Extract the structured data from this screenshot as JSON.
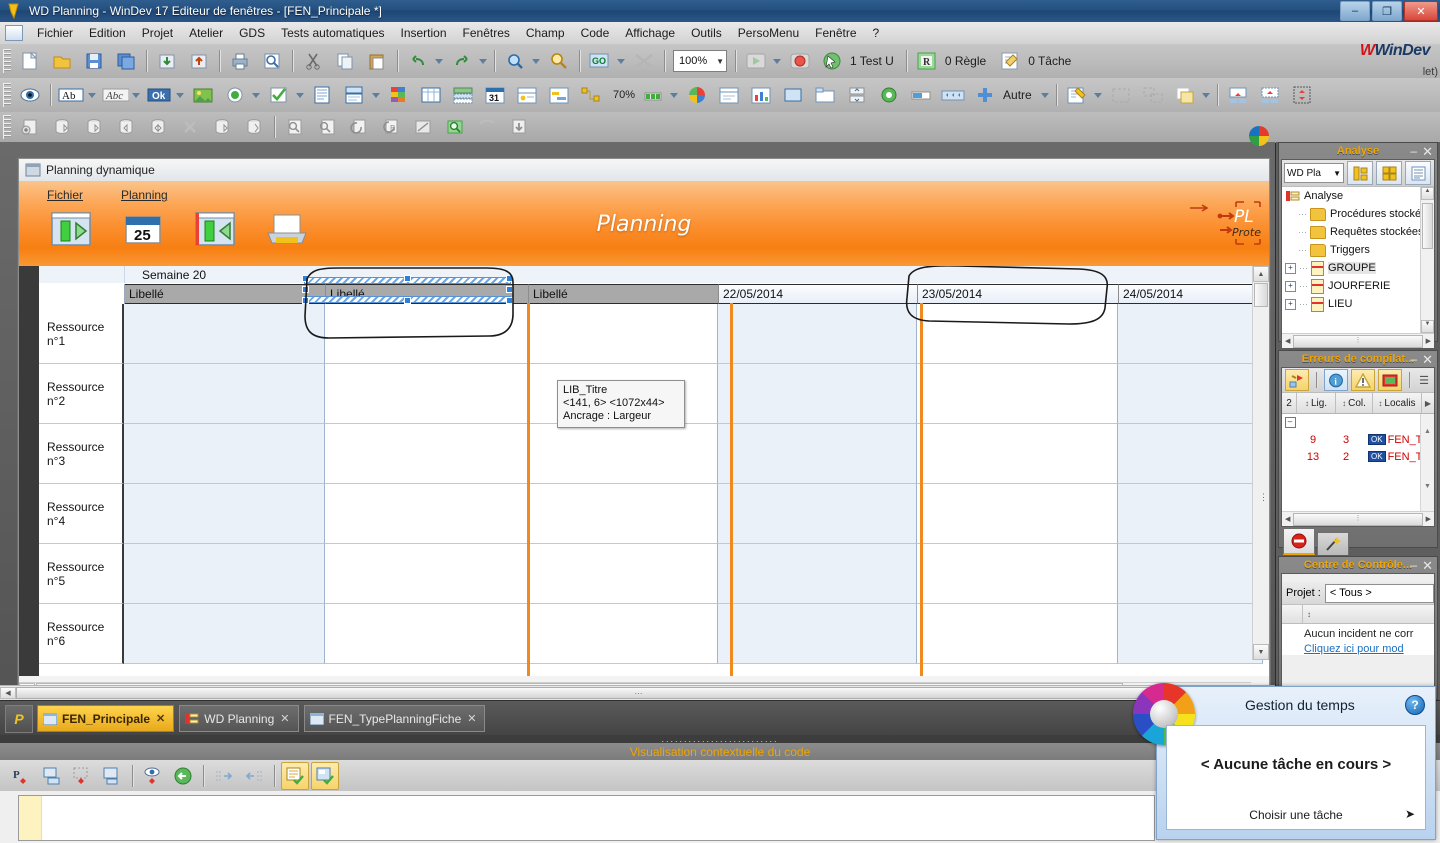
{
  "titlebar": {
    "text": "WD Planning - WinDev 17  Editeur de fenêtres - [FEN_Principale *]",
    "minimize": "–",
    "maximize": "❐",
    "close": "✕"
  },
  "menubar": {
    "items": [
      {
        "label": "Fichier"
      },
      {
        "label": "Edition"
      },
      {
        "label": "Projet"
      },
      {
        "label": "Atelier"
      },
      {
        "label": "GDS"
      },
      {
        "label": "Tests automatiques"
      },
      {
        "label": "Insertion"
      },
      {
        "label": "Fenêtres"
      },
      {
        "label": "Champ"
      },
      {
        "label": "Code"
      },
      {
        "label": "Affichage"
      },
      {
        "label": "Outils"
      },
      {
        "label": "PersoMenu"
      },
      {
        "label": "Fenêtre"
      },
      {
        "label": "?"
      }
    ]
  },
  "toolbar1": {
    "zoom_value": "100%",
    "test_label": "1 Test U",
    "rule_label": "0 Règle",
    "task_label": "0 Tâche"
  },
  "toolbar2": {
    "ab_label": "Ab",
    "abc_label": "Abc",
    "ok_label": "Ok",
    "pct_label": "70%",
    "autre_label": "Autre"
  },
  "brand": {
    "name": "WinDev",
    "suffix": "let)"
  },
  "child_window": {
    "title": "Planning dynamique",
    "banner_menu": [
      "Fichier",
      "Planning"
    ],
    "banner_title": "Planning",
    "banner_right_line1": "PL",
    "banner_right_line2": "Prote"
  },
  "tooltip": {
    "line1": "LIB_Titre",
    "line2": "<141, 6> <1072x44>",
    "line3": "Ancrage : Largeur"
  },
  "planning": {
    "week_label": "Semaine 20",
    "column_headers": [
      "Libellé",
      "Libellé",
      "Libellé",
      "22/05/2014",
      "23/05/2014",
      "24/05/2014"
    ],
    "resources": [
      "Ressource n°1",
      "Ressource n°2",
      "Ressource n°3",
      "Ressource n°4",
      "Ressource n°5",
      "Ressource n°6"
    ]
  },
  "panels": {
    "analyse": {
      "title": "Analyse",
      "minimize": "–",
      "close": "✕",
      "combo_value": "WD Pla",
      "combo_caret": "▾",
      "tree": [
        {
          "label": "Analyse",
          "type": "root",
          "indent": 0,
          "expander": ""
        },
        {
          "label": "Procédures stockée",
          "type": "folder",
          "indent": 1,
          "expander": ""
        },
        {
          "label": "Requêtes stockées",
          "type": "folder",
          "indent": 1,
          "expander": ""
        },
        {
          "label": "Triggers",
          "type": "folder",
          "indent": 1,
          "expander": ""
        },
        {
          "label": "GROUPE",
          "type": "table",
          "indent": 1,
          "expander": "+",
          "selected": true
        },
        {
          "label": "JOURFERIE",
          "type": "table",
          "indent": 1,
          "expander": "+"
        },
        {
          "label": "LIEU",
          "type": "table",
          "indent": 1,
          "expander": "+"
        }
      ]
    },
    "errors": {
      "title": "Erreurs de compilat...",
      "minimize": "–",
      "close": "✕",
      "count": "2",
      "columns": [
        "Lig.",
        "Col.",
        "Localis"
      ],
      "rows": [
        {
          "line": "9",
          "col": "3",
          "badge": "OK",
          "location": "FEN_T"
        },
        {
          "line": "13",
          "col": "2",
          "badge": "OK",
          "location": "FEN_T"
        }
      ]
    },
    "control_center": {
      "title": "Centre de Contrôle...",
      "minimize": "–",
      "close": "✕",
      "project_label": "Projet :",
      "project_value": "< Tous >",
      "empty_text": "Aucun incident ne corr",
      "link_text": "Cliquez ici pour mod"
    }
  },
  "tabs": {
    "wbutton": "P",
    "items": [
      {
        "label": "FEN_Principale",
        "close": "✕",
        "active": true
      },
      {
        "label": "WD Planning",
        "close": "✕",
        "active": false
      },
      {
        "label": "FEN_TypePlanningFiche",
        "close": "✕",
        "active": false
      }
    ]
  },
  "code_panel": {
    "header_dots": "..........................",
    "title": "Visualisation contextuelle du code"
  },
  "gestion_temps": {
    "title": "Gestion du temps",
    "help": "?",
    "status": "< Aucune tâche en cours >",
    "action": "Choisir une tâche",
    "arrow": "➤"
  },
  "colors": {
    "accent_orange": "#f0a500",
    "banner_orange": "#fb8d2b",
    "title_blue": "#23507f",
    "selection_blue": "#2f7fd9",
    "error_red": "#d00000",
    "link_blue": "#1a6fc4"
  }
}
